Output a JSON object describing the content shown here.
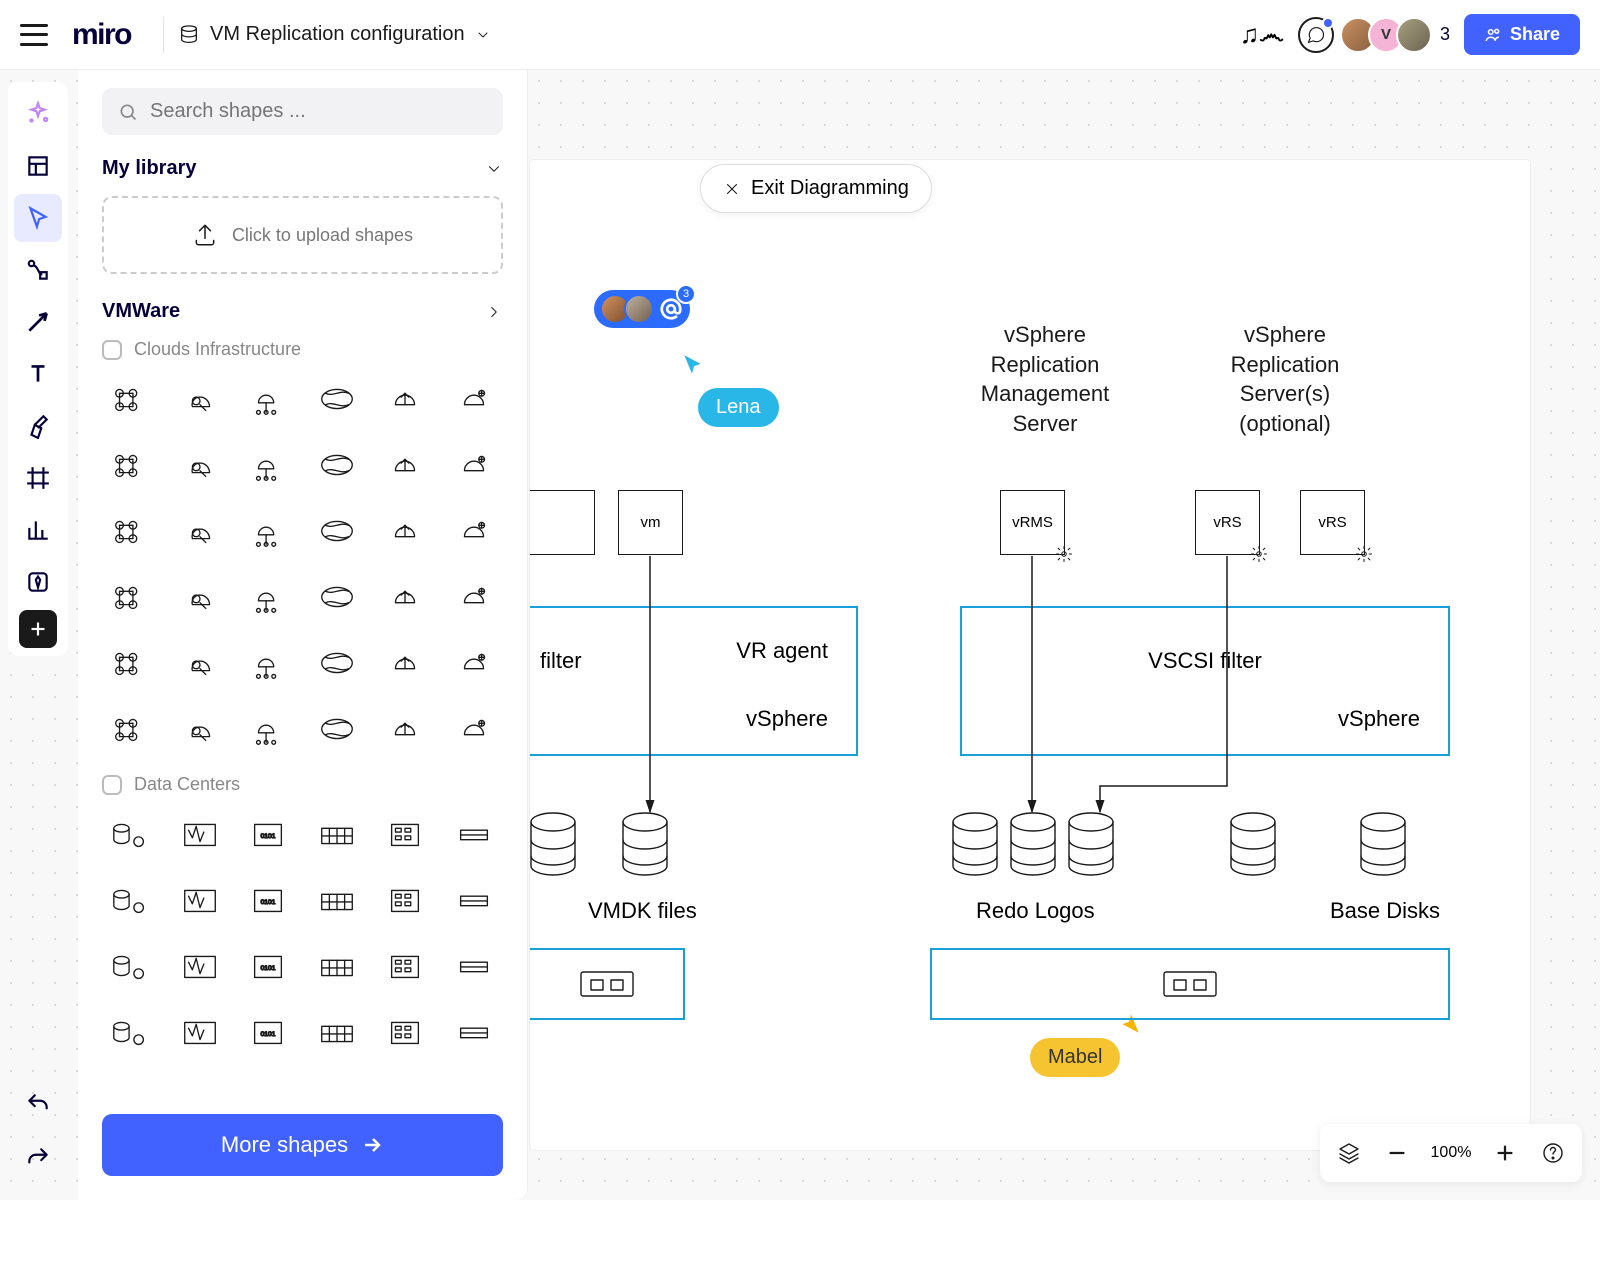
{
  "header": {
    "logo": "miro",
    "board_title": "VM Replication configuration",
    "share_label": "Share",
    "user_count": "3",
    "avatar_v_initial": "V"
  },
  "toolbar": {
    "items": [
      "ai",
      "template",
      "cursor",
      "flow",
      "arrow",
      "text",
      "marker",
      "frame",
      "chart",
      "app",
      "add"
    ]
  },
  "panel": {
    "search_placeholder": "Search shapes ...",
    "my_library": "My library",
    "upload_hint": "Click to upload shapes",
    "vmware": "VMWare",
    "cat_clouds": "Clouds Infrastructure",
    "cat_datacenters": "Data Centers",
    "more_shapes": "More shapes"
  },
  "canvas": {
    "exit_label": "Exit Diagramming",
    "labels": {
      "vsphere_mgmt": "vSphere\nReplication\nManagement\nServer",
      "vsphere_opt": "vSphere\nReplication\nServer(s)\n(optional)",
      "vm": "vm",
      "vrms": "vRMS",
      "vrs": "vRS",
      "filter_left_a": "VR agent",
      "filter_left_b": "vSphere",
      "filter_right_a": "VSCSI filter",
      "filter_right_b": "vSphere",
      "filter_partial": "filter",
      "vmdk": "VMDK files",
      "redo": "Redo Logos",
      "base": "Base Disks"
    },
    "cursors": {
      "lena": "Lena",
      "mabel": "Mabel"
    },
    "collab_count": "3"
  },
  "zoom": {
    "level": "100%"
  }
}
